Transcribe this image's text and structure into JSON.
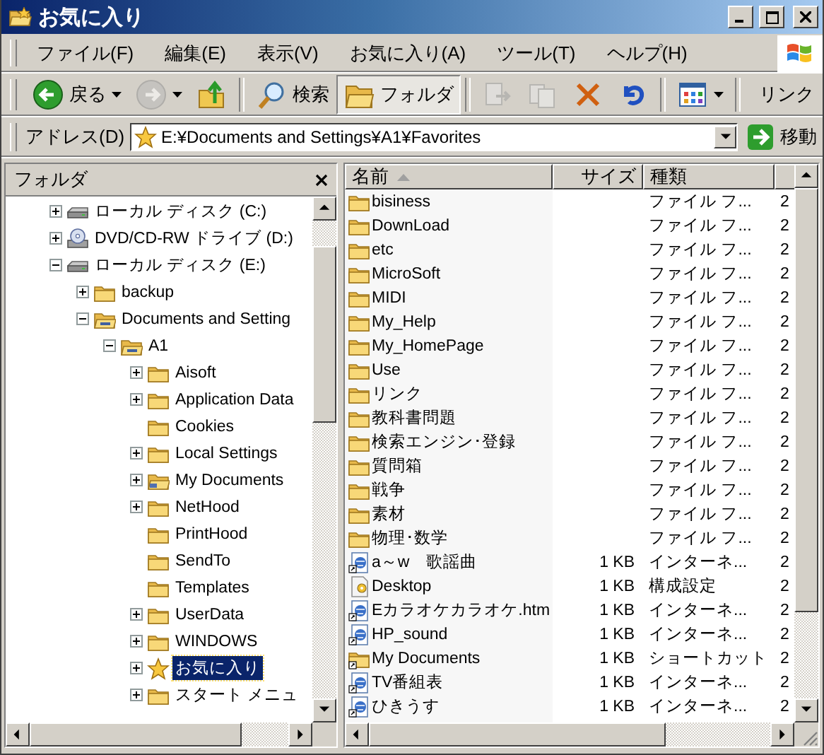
{
  "window": {
    "title": "お気に入り"
  },
  "menu": [
    {
      "label": "ファイル(F)"
    },
    {
      "label": "編集(E)"
    },
    {
      "label": "表示(V)"
    },
    {
      "label": "お気に入り(A)"
    },
    {
      "label": "ツール(T)"
    },
    {
      "label": "ヘルプ(H)"
    }
  ],
  "toolbar": [
    {
      "kind": "back",
      "label": "戻る",
      "dropdown": true,
      "disabled": false,
      "selected": false
    },
    {
      "kind": "forward",
      "dropdown": true,
      "disabled": true,
      "selected": false
    },
    {
      "kind": "up",
      "dropdown": false,
      "disabled": false,
      "selected": false
    },
    {
      "kind": "search",
      "label": "検索",
      "dropdown": false,
      "disabled": false,
      "selected": false
    },
    {
      "kind": "folders",
      "label": "フォルダ",
      "dropdown": false,
      "disabled": false,
      "selected": true
    },
    {
      "kind": "move",
      "dropdown": false,
      "disabled": true,
      "selected": false
    },
    {
      "kind": "copy",
      "dropdown": false,
      "disabled": true,
      "selected": false
    },
    {
      "kind": "delete",
      "dropdown": false,
      "disabled": false,
      "selected": false
    },
    {
      "kind": "undo",
      "dropdown": false,
      "disabled": false,
      "selected": false
    },
    {
      "kind": "views",
      "dropdown": true,
      "disabled": false,
      "selected": false
    }
  ],
  "links": "リンク",
  "address": {
    "label": "アドレス(D)",
    "value": "E:¥Documents and Settings¥A1¥Favorites",
    "go": "移動"
  },
  "folder_pane": {
    "title": "フォルダ",
    "tree": [
      {
        "label": "ローカル ディスク (C:)",
        "kind": "drive",
        "expanded": false,
        "selected": false
      },
      {
        "label": "DVD/CD-RW ドライブ (D:)",
        "kind": "cd",
        "expanded": false,
        "selected": false
      },
      {
        "label": "ローカル ディスク (E:)",
        "kind": "drive",
        "expanded": true,
        "selected": false,
        "children": [
          {
            "label": "backup",
            "kind": "folder",
            "expanded": false,
            "selected": false
          },
          {
            "label": "Documents and Setting",
            "kind": "open-folder",
            "expanded": true,
            "selected": false,
            "children": [
              {
                "label": "A1",
                "kind": "open-folder",
                "expanded": true,
                "selected": false,
                "children": [
                  {
                    "label": "Aisoft",
                    "kind": "folder",
                    "expanded": false,
                    "selected": false
                  },
                  {
                    "label": "Application Data",
                    "kind": "folder",
                    "expanded": false,
                    "selected": false
                  },
                  {
                    "label": "Cookies",
                    "kind": "folder",
                    "selected": false
                  },
                  {
                    "label": "Local Settings",
                    "kind": "folder",
                    "expanded": false,
                    "selected": false
                  },
                  {
                    "label": "My Documents",
                    "kind": "documents",
                    "expanded": false,
                    "selected": false
                  },
                  {
                    "label": "NetHood",
                    "kind": "folder",
                    "expanded": false,
                    "selected": false
                  },
                  {
                    "label": "PrintHood",
                    "kind": "folder",
                    "selected": false
                  },
                  {
                    "label": "SendTo",
                    "kind": "folder",
                    "selected": false
                  },
                  {
                    "label": "Templates",
                    "kind": "folder",
                    "selected": false
                  },
                  {
                    "label": "UserData",
                    "kind": "folder",
                    "expanded": false,
                    "selected": false
                  },
                  {
                    "label": "WINDOWS",
                    "kind": "folder",
                    "expanded": false,
                    "selected": false
                  },
                  {
                    "label": "お気に入り",
                    "kind": "star",
                    "expanded": false,
                    "selected": true
                  },
                  {
                    "label": "スタート メニュ",
                    "kind": "folder",
                    "expanded": false,
                    "selected": false
                  }
                ]
              }
            ]
          }
        ]
      }
    ]
  },
  "file_list": {
    "columns": [
      {
        "label": "名前",
        "sorted": true
      },
      {
        "label": "サイズ",
        "sorted": false
      },
      {
        "label": "種類",
        "sorted": false
      }
    ],
    "rows": [
      {
        "kind": "folder",
        "name": "bisiness",
        "type": "ファイル フ...",
        "date": "2"
      },
      {
        "kind": "folder",
        "name": "DownLoad",
        "type": "ファイル フ...",
        "date": "2"
      },
      {
        "kind": "folder",
        "name": "etc",
        "type": "ファイル フ...",
        "date": "2"
      },
      {
        "kind": "folder",
        "name": "MicroSoft",
        "type": "ファイル フ...",
        "date": "2"
      },
      {
        "kind": "folder",
        "name": "MIDI",
        "type": "ファイル フ...",
        "date": "2"
      },
      {
        "kind": "folder",
        "name": "My_Help",
        "type": "ファイル フ...",
        "date": "2"
      },
      {
        "kind": "folder",
        "name": "My_HomePage",
        "type": "ファイル フ...",
        "date": "2"
      },
      {
        "kind": "folder",
        "name": "Use",
        "type": "ファイル フ...",
        "date": "2"
      },
      {
        "kind": "folder",
        "name": "リンク",
        "type": "ファイル フ...",
        "date": "2"
      },
      {
        "kind": "folder",
        "name": "教科書問題",
        "type": "ファイル フ...",
        "date": "2"
      },
      {
        "kind": "folder",
        "name": "検索エンジン･登録",
        "type": "ファイル フ...",
        "date": "2"
      },
      {
        "kind": "folder",
        "name": "質問箱",
        "type": "ファイル フ...",
        "date": "2"
      },
      {
        "kind": "folder",
        "name": "戦争",
        "type": "ファイル フ...",
        "date": "2"
      },
      {
        "kind": "folder",
        "name": "素材",
        "type": "ファイル フ...",
        "date": "2"
      },
      {
        "kind": "folder",
        "name": "物理･数学",
        "type": "ファイル フ...",
        "date": "2"
      },
      {
        "kind": "web",
        "name": "a～w　歌謡曲",
        "size": "1 KB",
        "type": "インターネ...",
        "date": "2"
      },
      {
        "kind": "settings",
        "name": "Desktop",
        "size": "1 KB",
        "type": "構成設定",
        "date": "2"
      },
      {
        "kind": "web",
        "name": "Eカラオケカラオケ.htm",
        "size": "1 KB",
        "type": "インターネ...",
        "date": "2"
      },
      {
        "kind": "web",
        "name": "HP_sound",
        "size": "1 KB",
        "type": "インターネ...",
        "date": "2"
      },
      {
        "kind": "folder-shortcut",
        "name": "My Documents",
        "size": "1 KB",
        "type": "ショートカット",
        "date": "2"
      },
      {
        "kind": "web",
        "name": "TV番組表",
        "size": "1 KB",
        "type": "インターネ...",
        "date": "2"
      },
      {
        "kind": "web",
        "name": "ひきうす",
        "size": "1 KB",
        "type": "インターネ...",
        "date": "2"
      }
    ]
  }
}
